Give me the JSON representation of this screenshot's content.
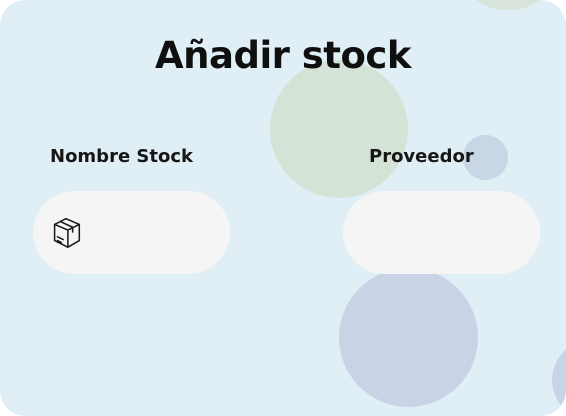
{
  "form": {
    "title": "Añadir stock",
    "fields": [
      {
        "label": "Nombre Stock",
        "value": "",
        "placeholder": "",
        "icon": "package-box-icon"
      },
      {
        "label": "Proveedor",
        "value": "",
        "placeholder": ""
      }
    ]
  },
  "colors": {
    "card_background": "#e0eef5",
    "input_background": "#f5f5f5",
    "text": "#0f0f0f"
  }
}
